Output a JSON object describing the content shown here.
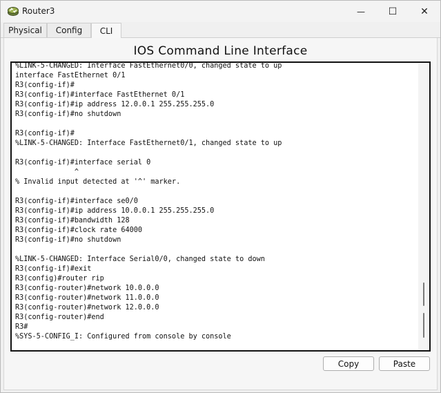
{
  "window": {
    "title": "Router3",
    "minimize_glyph": "—",
    "maximize_glyph": "☐",
    "close_glyph": "✕"
  },
  "tabs": [
    {
      "label": "Physical",
      "active": false
    },
    {
      "label": "Config",
      "active": false
    },
    {
      "label": "CLI",
      "active": true
    }
  ],
  "cli": {
    "heading": "IOS Command Line Interface",
    "output": "%LINK-5-CHANGED: Interface FastEthernet0/0, changed state to up\ninterface FastEthernet 0/1\nR3(config-if)#\nR3(config-if)#interface FastEthernet 0/1\nR3(config-if)#ip address 12.0.0.1 255.255.255.0\nR3(config-if)#no shutdown\n\nR3(config-if)#\n%LINK-5-CHANGED: Interface FastEthernet0/1, changed state to up\n\nR3(config-if)#interface serial 0\n              ^\n% Invalid input detected at '^' marker.\n\nR3(config-if)#interface se0/0\nR3(config-if)#ip address 10.0.0.1 255.255.255.0\nR3(config-if)#bandwidth 128\nR3(config-if)#clock rate 64000\nR3(config-if)#no shutdown\n\n%LINK-5-CHANGED: Interface Serial0/0, changed state to down\nR3(config-if)#exit\nR3(config)#router rip\nR3(config-router)#network 10.0.0.0\nR3(config-router)#network 11.0.0.0\nR3(config-router)#network 12.0.0.0\nR3(config-router)#end\nR3#\n%SYS-5-CONFIG_I: Configured from console by console"
  },
  "buttons": {
    "copy": "Copy",
    "paste": "Paste"
  },
  "icons": {
    "app": "router-icon"
  }
}
